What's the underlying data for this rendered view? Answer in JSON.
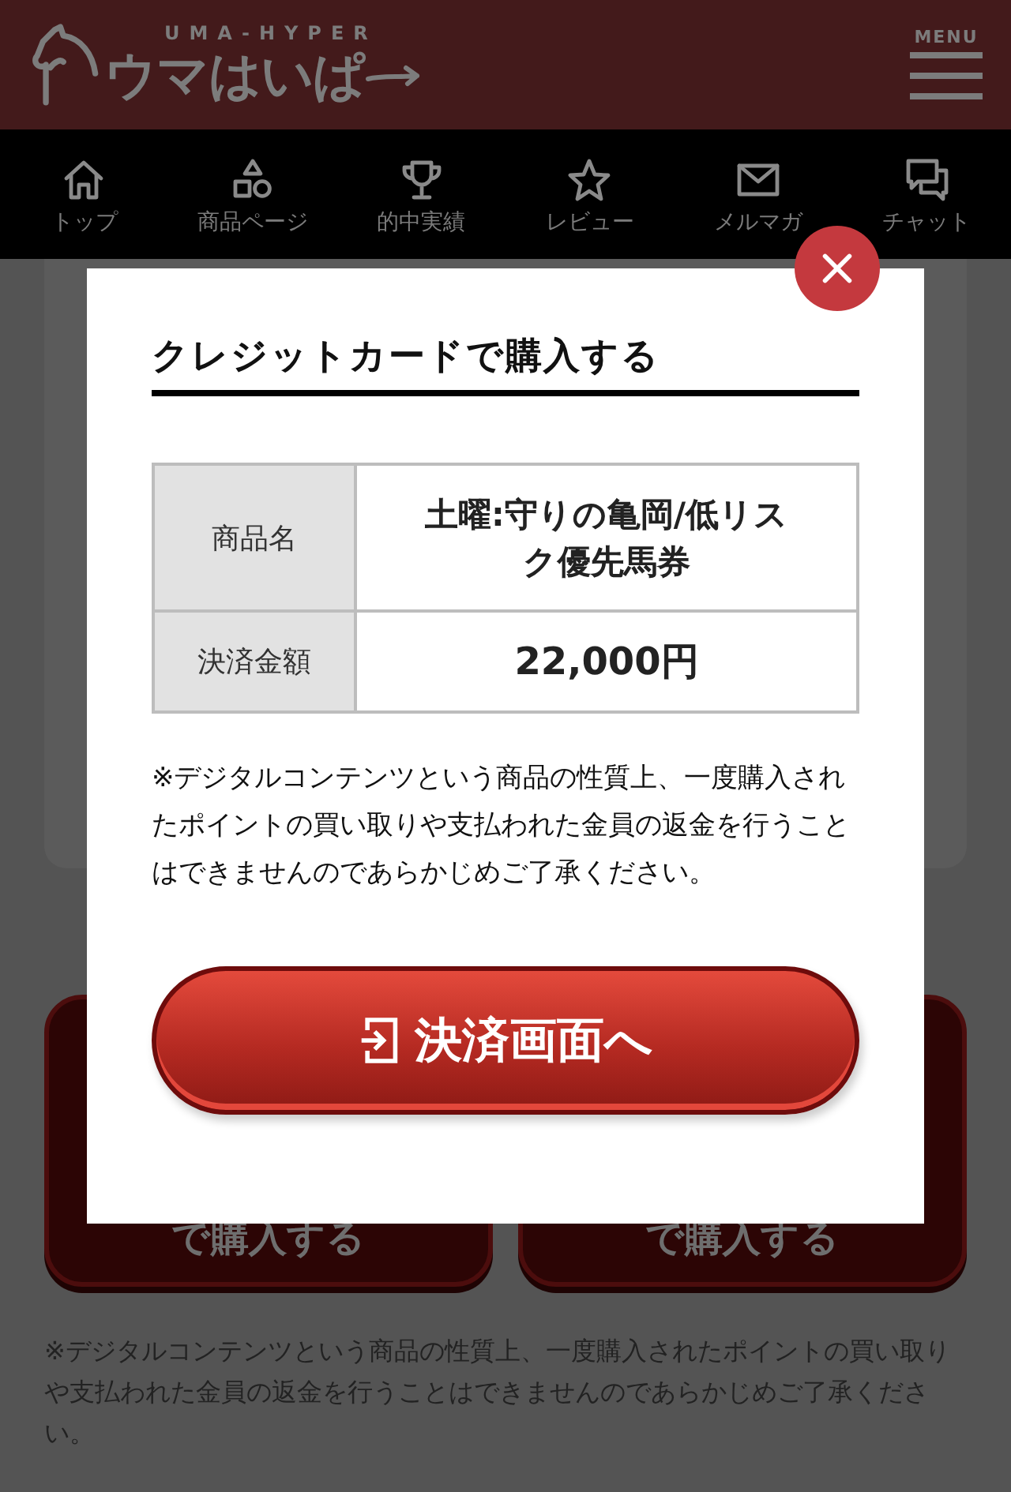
{
  "header": {
    "tagline": "UMA-HYPER",
    "logo_text": "ウマはいぱ",
    "menu_label": "MENU"
  },
  "nav": [
    {
      "label": "トップ"
    },
    {
      "label": "商品ページ"
    },
    {
      "label": "的中実績"
    },
    {
      "label": "レビュー"
    },
    {
      "label": "メルマガ"
    },
    {
      "label": "チャット"
    }
  ],
  "background": {
    "buttons": [
      {
        "label": "で購入する"
      },
      {
        "label": "で購入する"
      }
    ],
    "note": "※デジタルコンテンツという商品の性質上、一度購入されたポイントの買い取りや支払われた金員の返金を行うことはできませんのであらかじめご了承ください。"
  },
  "modal": {
    "title": "クレジットカードで購入する",
    "rows": [
      {
        "label": "商品名",
        "value": "土曜:守りの亀岡/低リスク優先馬券"
      },
      {
        "label": "決済金額",
        "value": "22,000円"
      }
    ],
    "note": "※デジタルコンテンツという商品の性質上、一度購入されたポイントの買い取りや支払われた金員の返金を行うことはできませんのであらかじめご了承ください。",
    "action": "決済画面へ"
  }
}
